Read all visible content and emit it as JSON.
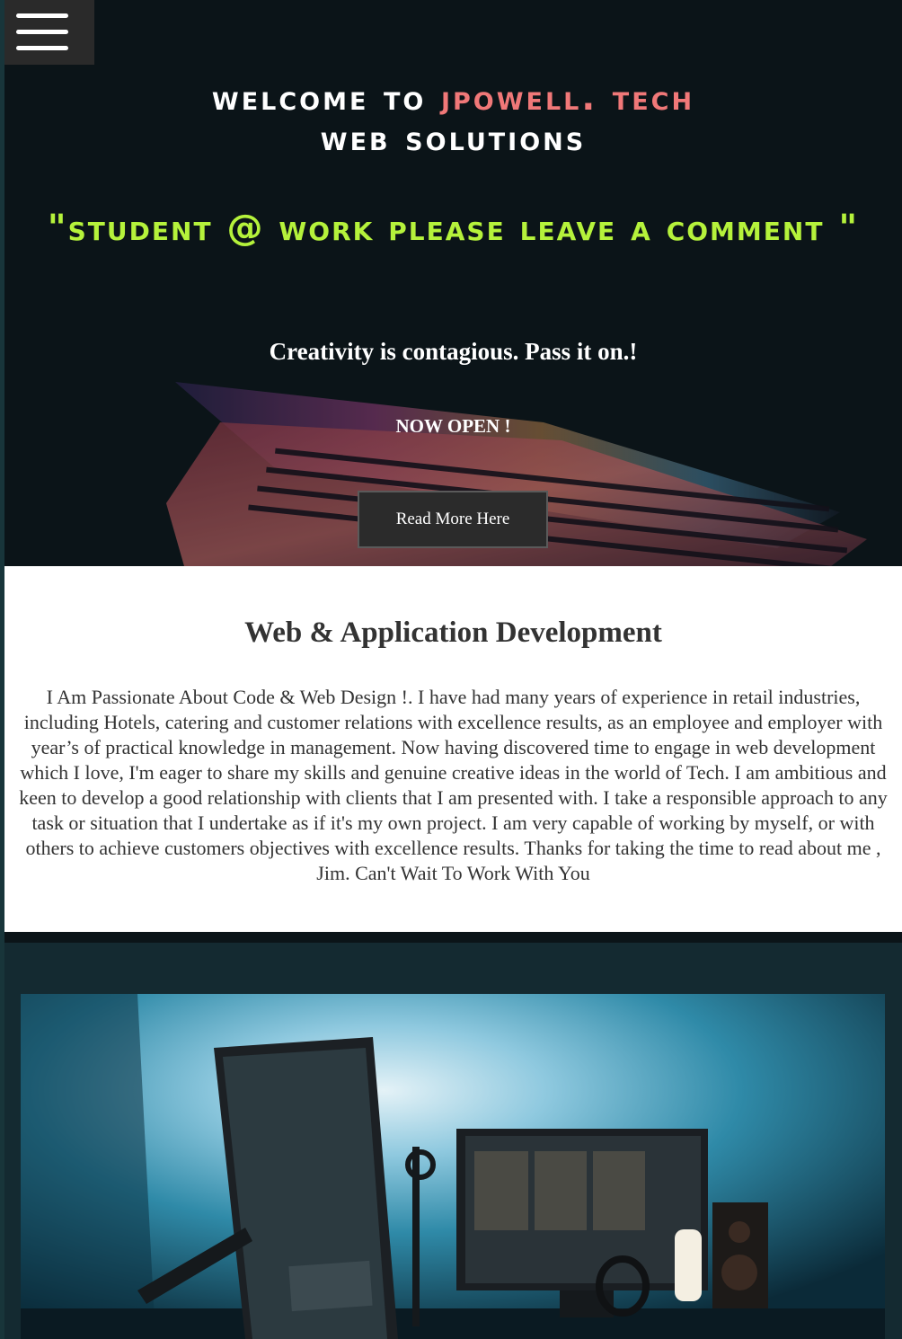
{
  "nav": {
    "menu_icon": "hamburger-menu-icon"
  },
  "hero": {
    "title_prefix": "Welcome to ",
    "brand": "JPowell. Tech",
    "title_line2": "Web Solutions",
    "quote": "\"Student @ Work please leave a comment \"",
    "tagline": "Creativity is contagious. Pass it on.!",
    "status": "NOW OPEN !",
    "button_label": "Read More Here"
  },
  "about": {
    "heading": "Web & Application Development",
    "body": "I Am Passionate About Code & Web Design !. I have had many years of experience in retail industries, including Hotels, catering and customer relations with excellence results, as an employee and employer with year’s of practical knowledge in management. Now having discovered time to engage in web development which I love, I'm eager to share my skills and genuine creative ideas in the world of Tech. I am ambitious and keen to develop a good relationship with clients that I am presented with. I take a responsible approach to any task or situation that I undertake as if it's my own project. I am very capable of working by myself, or with others to achieve customers objectives with excellence results. Thanks for taking the time to read about me , Jim. Can't Wait To Work With You"
  },
  "colors": {
    "brand": "#f07878",
    "quote": "#b5f23b",
    "hero_bg": "#0b1519",
    "lower_bg": "#142a31"
  }
}
